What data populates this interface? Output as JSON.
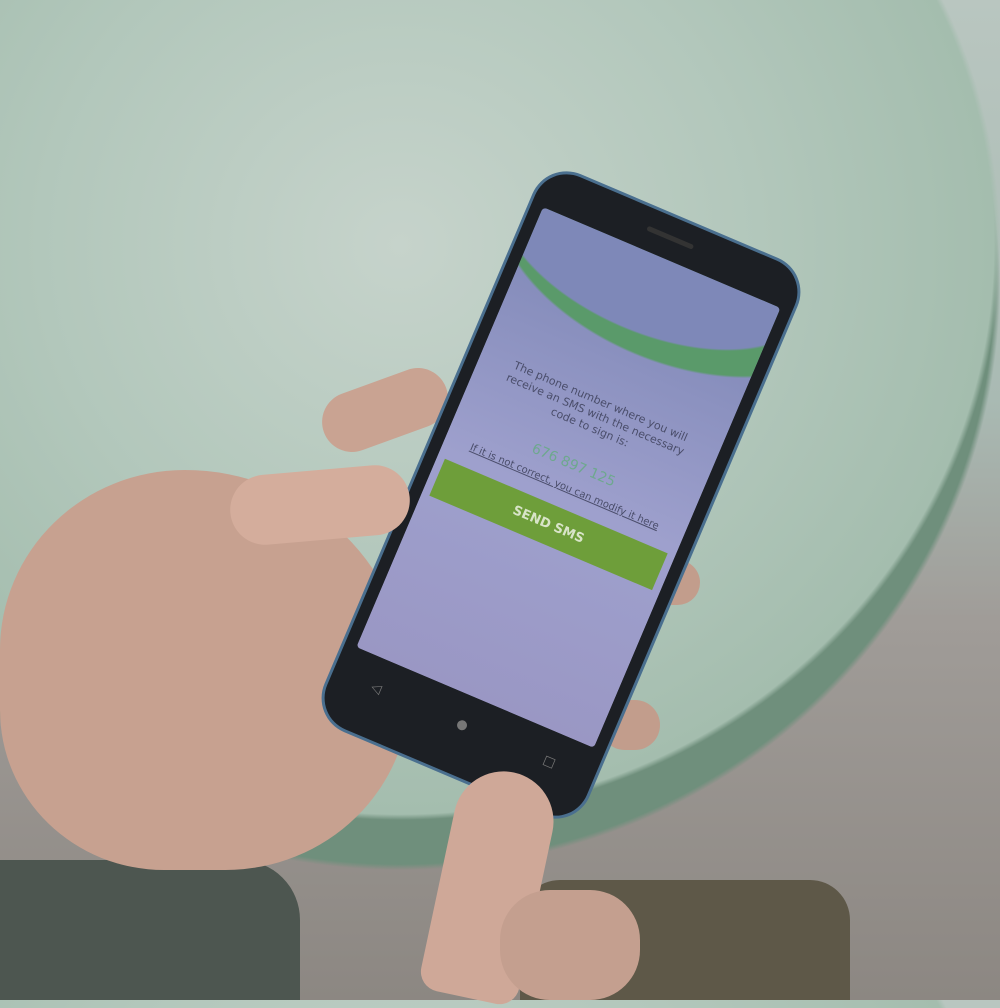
{
  "screen": {
    "message": "The phone number where you will receive an SMS with the necessary code to sign is:",
    "phone_number": "676 897 125",
    "modify_link": "If it is not correct, you can modify it here",
    "send_button": "SEND SMS"
  },
  "navbar": {
    "back": "◁",
    "home": "●",
    "recents": "□"
  },
  "colors": {
    "accent": "#6e9e3a",
    "screen_bg": "#9ea0cd",
    "number": "#6ea88e"
  }
}
